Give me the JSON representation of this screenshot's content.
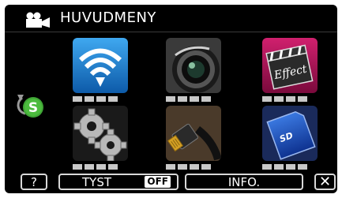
{
  "header": {
    "title": "HUVUDMENY",
    "icon": "video-camera-icon"
  },
  "tiles": [
    {
      "name": "wifi",
      "icon": "wifi-icon"
    },
    {
      "name": "lens",
      "icon": "camera-lens-icon"
    },
    {
      "name": "effect",
      "icon": "effect-clapboard-icon",
      "label": "Effect"
    },
    {
      "name": "settings",
      "icon": "gears-icon"
    },
    {
      "name": "connection",
      "icon": "hdmi-cable-icon"
    },
    {
      "name": "media",
      "icon": "sd-card-icon",
      "label": "SD"
    }
  ],
  "side": {
    "icon": "return-s-icon",
    "letter": "S"
  },
  "footer": {
    "help_label": "?",
    "tyst_label": "TYST",
    "tyst_state": "OFF",
    "info_label": "INFO.",
    "close_label": "✕"
  },
  "colors": {
    "background": "#000000",
    "button_border": "#d8d8d8",
    "wifi_tile": "#1a7fd0",
    "effect_tile": "#b3115a",
    "media_tile": "#1a4fb8",
    "return_badge": "#3fa535"
  }
}
